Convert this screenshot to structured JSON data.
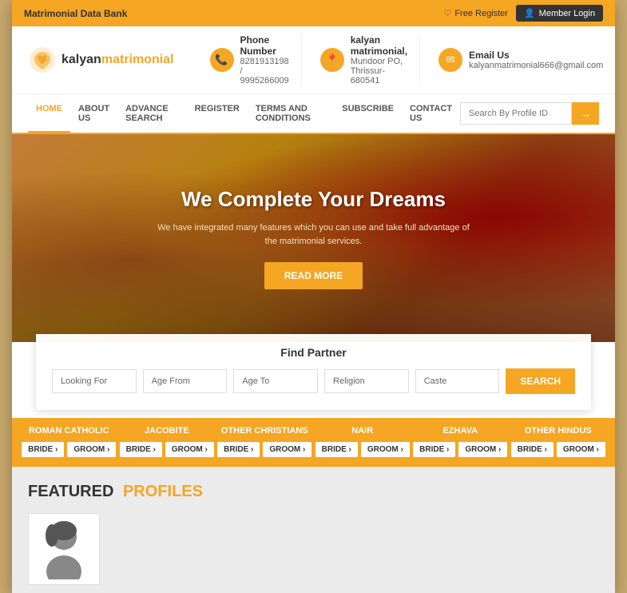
{
  "topBar": {
    "title": "Matrimonial Data Bank",
    "freeRegister": "Free Register",
    "memberLogin": "Member Login"
  },
  "header": {
    "logoText": "kalyan",
    "logoSub": "matrimonial",
    "contact1": {
      "label": "Phone Number",
      "value1": "8281913198",
      "value2": "9995266009"
    },
    "contact2": {
      "label": "kalyan matrimonial,",
      "value": "Mundoor PO, Thrissur-680541"
    },
    "contact3": {
      "label": "Email Us",
      "value": "kalyanmatrimonial666@gmail.com"
    }
  },
  "nav": {
    "links": [
      "HOME",
      "ABOUT US",
      "ADVANCE SEARCH",
      "REGISTER",
      "TERMS AND CONDITIONS",
      "SUBSCRIBE",
      "CONTACT US"
    ],
    "activeIndex": 0,
    "searchPlaceholder": "Search By Profile ID"
  },
  "hero": {
    "title": "We Complete Your Dreams",
    "desc": "We have integrated many features which you can use and take full advantage of the matrimonial services.",
    "btnLabel": "READ MORE"
  },
  "searchBox": {
    "title": "Find Partner",
    "fields": {
      "lookingFor": "Looking For",
      "ageFrom": "Age From",
      "ageTo": "Age To",
      "religion": "Religion",
      "caste": "Caste"
    },
    "btnLabel": "SEARCH"
  },
  "categories": [
    {
      "name": "ROMAN CATHOLIC",
      "bride": "BRIDE",
      "groom": "GROOM"
    },
    {
      "name": "JACOBITE",
      "bride": "BRIDE",
      "groom": "GROOM"
    },
    {
      "name": "OTHER CHRISTIANS",
      "bride": "BRIDE",
      "groom": "GROOM"
    },
    {
      "name": "NAIR",
      "bride": "BRIDE",
      "groom": "GROOM"
    },
    {
      "name": "EZHAVA",
      "bride": "BRIDE",
      "groom": "GROOM"
    },
    {
      "name": "OTHER HINDUS",
      "bride": "BRIDE",
      "groom": "GROOM"
    }
  ],
  "featured": {
    "title": "FEATURED",
    "subtitle": "PROFILES"
  }
}
